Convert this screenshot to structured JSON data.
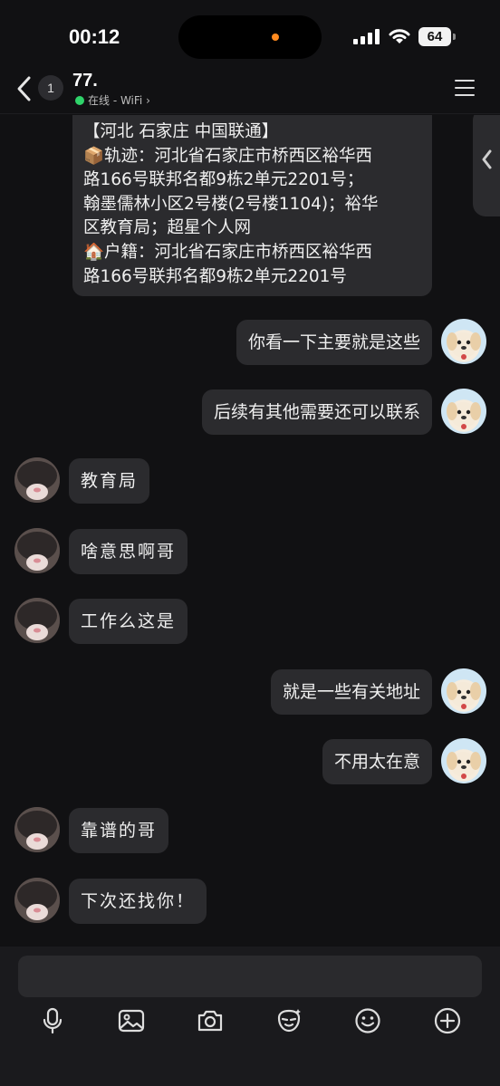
{
  "status_bar": {
    "time": "00:12",
    "battery": "64"
  },
  "header": {
    "unread_count": "1",
    "contact_name": "77.",
    "status": "在线 - WiFi ›"
  },
  "big_message": {
    "lines": [
      "【河北 石家庄 中国联通】",
      "📦轨迹：河北省石家庄市桥西区裕华西",
      "路166号联邦名都9栋2单元2201号；",
      "翰墨儒林小区2号楼(2号楼1104)；裕华",
      "区教育局；超星个人网",
      "🏠户籍：河北省石家庄市桥西区裕华西",
      "路166号联邦名都9栋2单元2201号"
    ]
  },
  "messages": [
    {
      "sender": "me",
      "text": "你看一下主要就是这些"
    },
    {
      "sender": "me",
      "text": "后续有其他需要还可以联系"
    },
    {
      "sender": "other",
      "text": "教育局"
    },
    {
      "sender": "other",
      "text": "啥意思啊哥"
    },
    {
      "sender": "other",
      "text": "工作么这是"
    },
    {
      "sender": "me",
      "text": "就是一些有关地址"
    },
    {
      "sender": "me",
      "text": "不用太在意"
    },
    {
      "sender": "other",
      "text": "靠谱的哥"
    },
    {
      "sender": "other",
      "text": "下次还找你！"
    }
  ],
  "toolbar": {
    "icons": [
      "microphone-icon",
      "image-icon",
      "camera-icon",
      "sticker-icon",
      "emoji-icon",
      "plus-icon"
    ]
  },
  "colors": {
    "background": "#111113",
    "bubble": "#2b2b2e",
    "online": "#2fd36a",
    "accent_dot": "#ff8a1f"
  }
}
